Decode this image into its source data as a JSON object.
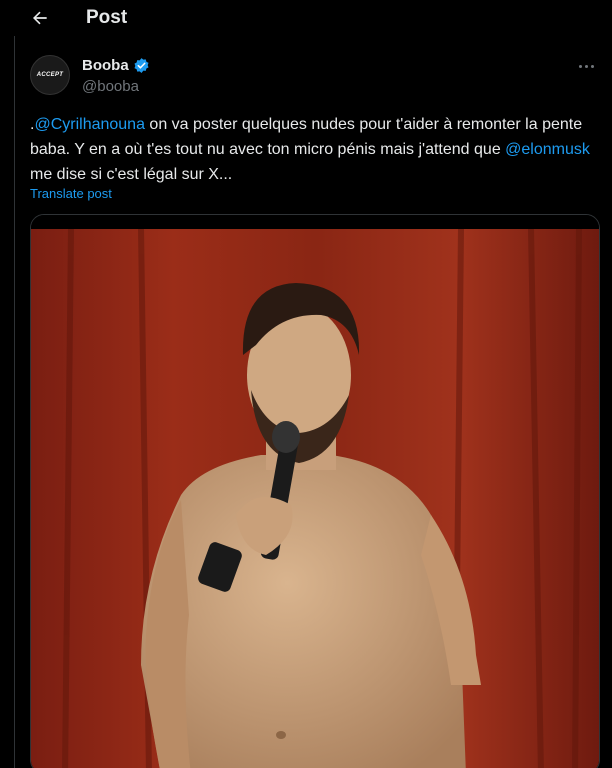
{
  "header": {
    "title": "Post",
    "back_icon": "arrow-left-icon"
  },
  "author": {
    "avatar_text": "ACCEPT",
    "name": "Booba",
    "handle": "@booba",
    "verified_icon": "verified-badge-icon",
    "verified_color": "#1d9bf0"
  },
  "tweet": {
    "prefix": ".",
    "mention1": "@Cyrilhanouna",
    "text1": " on va poster quelques nudes pour t'aider à remonter la pente baba. Y en a où t'es tout nu avec ton micro pénis mais j'attend que ",
    "mention2": "@elonmusk",
    "text2": " me dise si c'est légal sur X...",
    "translate_label": "Translate post"
  },
  "media": {
    "kind": "photo"
  },
  "colors": {
    "background": "#000000",
    "text": "#e7e9ea",
    "muted": "#71767b",
    "accent": "#1d9bf0",
    "border": "#2f3336"
  }
}
